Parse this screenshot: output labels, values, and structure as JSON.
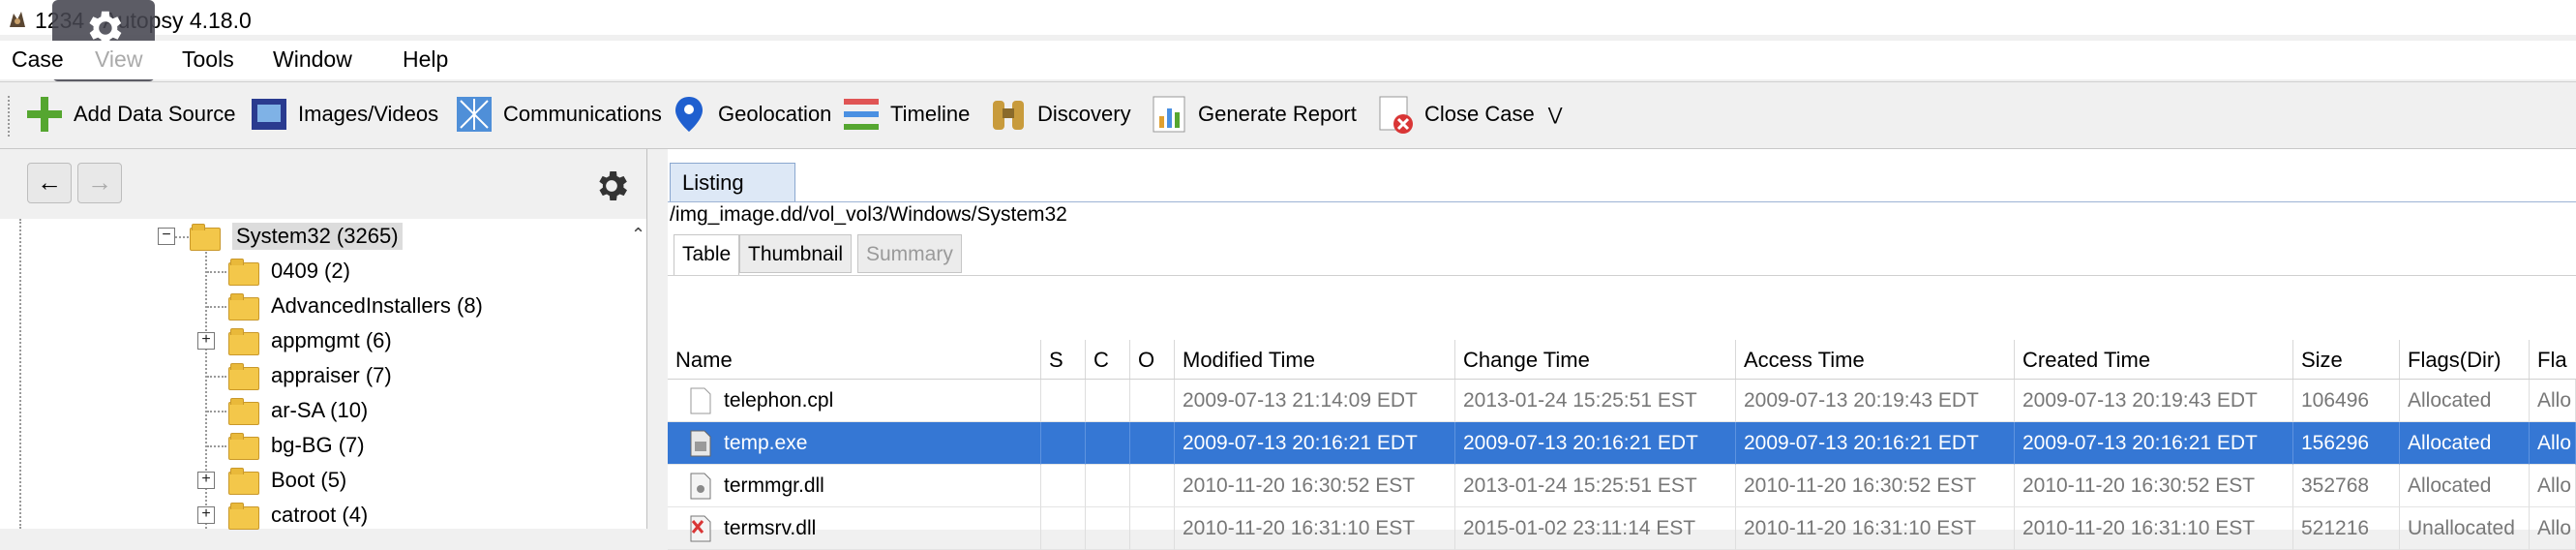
{
  "window": {
    "title": "1234 - Autopsy 4.18.0"
  },
  "menu": [
    "Case",
    "View",
    "Tools",
    "Window",
    "Help"
  ],
  "toolbar": {
    "add_data_source": "Add Data Source",
    "images_videos": "Images/Videos",
    "communications": "Communications",
    "geolocation": "Geolocation",
    "timeline": "Timeline",
    "discovery": "Discovery",
    "generate_report": "Generate Report",
    "close_case": "Close Case"
  },
  "nav": {
    "back": "←",
    "forward": "→"
  },
  "tree": {
    "root": "System32 (3265)",
    "items": [
      "0409 (2)",
      "AdvancedInstallers (8)",
      "appmgmt (6)",
      "appraiser (7)",
      "ar-SA (10)",
      "bg-BG (7)",
      "Boot (5)",
      "catroot (4)"
    ]
  },
  "listing": {
    "tab": "Listing",
    "path": "/img_image.dd/vol_vol3/Windows/System32",
    "subtabs": [
      "Table",
      "Thumbnail",
      "Summary"
    ],
    "columns": [
      "Name",
      "S",
      "C",
      "O",
      "Modified Time",
      "Change Time",
      "Access Time",
      "Created Time",
      "Size",
      "Flags(Dir)",
      "Fla"
    ],
    "rows": [
      {
        "name": "telephon.cpl",
        "modified": "2009-07-13 21:14:09 EDT",
        "change": "2013-01-24 15:25:51 EST",
        "access": "2009-07-13 20:19:43 EDT",
        "created": "2009-07-13 20:19:43 EDT",
        "size": "106496",
        "flags_dir": "Allocated",
        "flags_meta": "Allo"
      },
      {
        "name": "temp.exe",
        "modified": "2009-07-13 20:16:21 EDT",
        "change": "2009-07-13 20:16:21 EDT",
        "access": "2009-07-13 20:16:21 EDT",
        "created": "2009-07-13 20:16:21 EDT",
        "size": "156296",
        "flags_dir": "Allocated",
        "flags_meta": "Allo"
      },
      {
        "name": "termmgr.dll",
        "modified": "2010-11-20 16:30:52 EST",
        "change": "2013-01-24 15:25:51 EST",
        "access": "2010-11-20 16:30:52 EST",
        "created": "2010-11-20 16:30:52 EST",
        "size": "352768",
        "flags_dir": "Allocated",
        "flags_meta": "Allo"
      },
      {
        "name": "termsrv.dll",
        "modified": "2010-11-20 16:31:10 EST",
        "change": "2015-01-02 23:11:14 EST",
        "access": "2010-11-20 16:31:10 EST",
        "created": "2010-11-20 16:31:10 EST",
        "size": "521216",
        "flags_dir": "Unallocated",
        "flags_meta": "Allo"
      }
    ]
  },
  "colors": {
    "selection": "#3577d4",
    "folder": "#f3c74a",
    "tab_active": "#dde8f6"
  }
}
